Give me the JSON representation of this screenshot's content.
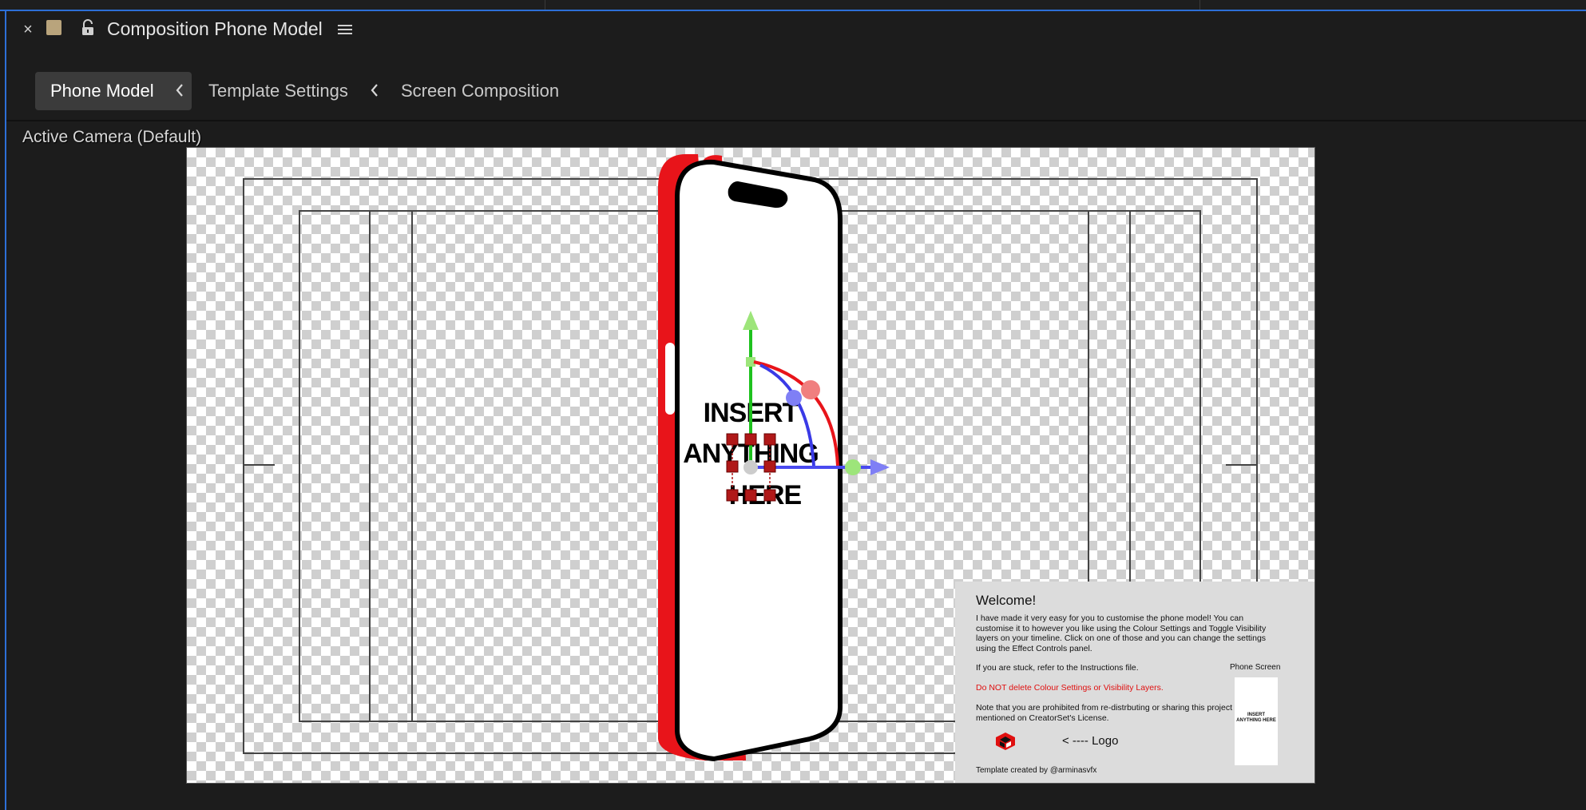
{
  "panel": {
    "title": "Composition Phone Model",
    "close_glyph": "×"
  },
  "tabs": [
    {
      "label": "Phone Model",
      "active": true
    },
    {
      "label": "Template Settings",
      "active": false
    },
    {
      "label": "Screen Composition",
      "active": false
    }
  ],
  "viewer": {
    "camera_label": "Active Camera (Default)",
    "phone_text": [
      "INSERT",
      "ANYTHING",
      "HERE"
    ]
  },
  "welcome": {
    "title": "Welcome!",
    "paragraph1": "I have made it very easy for you to customise the phone model! You can customise it to however you like using the Colour Settings and Toggle Visibility layers on your timeline. Click on one of those and you can change the settings using the Effect Controls panel.",
    "paragraph2": "If you are stuck, refer to the Instructions file.",
    "warning": "Do NOT delete Colour Settings or Visibility Layers.",
    "paragraph3": "Note that you are prohibited from re-distrbuting or sharing this project file as mentioned on CreatorSet's License.",
    "phone_screen_label": "Phone Screen",
    "mini_screen_text": "INSERT ANYTHING HERE",
    "logo_label": "< ---- Logo",
    "credit": "Template created by @arminasvfx"
  },
  "colors": {
    "accent_blue": "#2d6fd6",
    "swatch": "#b9a47c",
    "phone_red": "#e8141a",
    "warning_red": "#e01010"
  },
  "icons": [
    "close-icon",
    "composition-swatch-icon",
    "lock-icon",
    "panel-menu-icon",
    "chevron-left-icon",
    "logo-icon"
  ]
}
